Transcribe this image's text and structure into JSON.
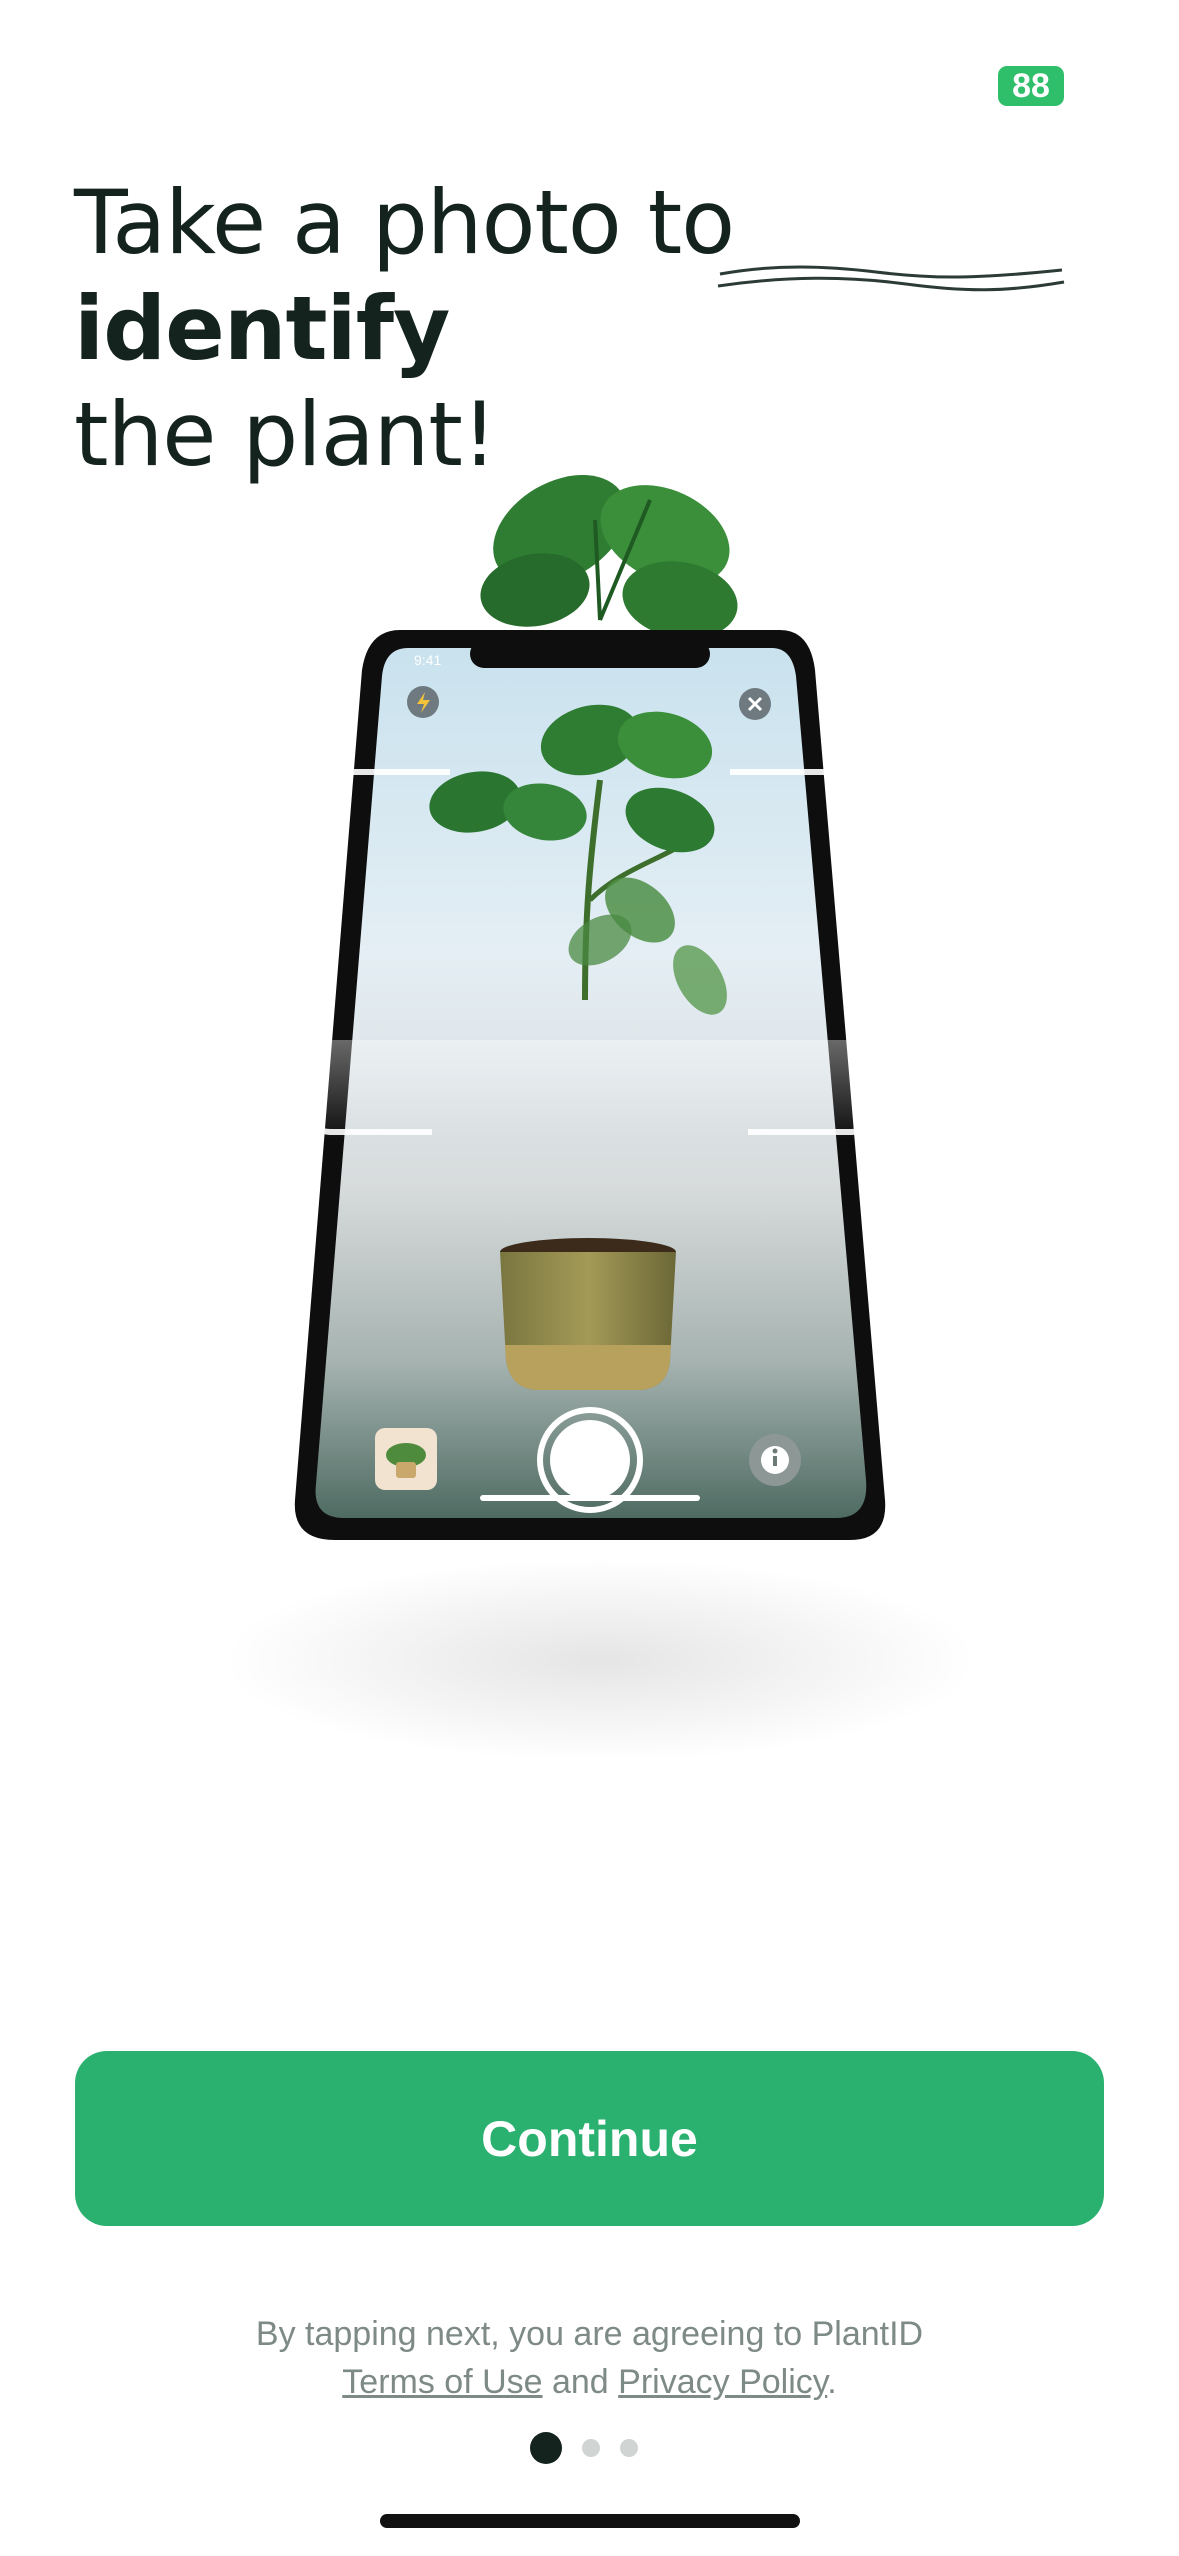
{
  "status_bar": {
    "battery": "88"
  },
  "headline": {
    "part1": "Take a photo to ",
    "emphasis": "identify",
    "part2": "the plant!"
  },
  "phone_screen": {
    "time": "9:41"
  },
  "primary_button": {
    "label": "Continue"
  },
  "legal": {
    "prefix": "By tapping next, you are agreeing to PlantID",
    "terms": "Terms of Use",
    "and": " and ",
    "privacy": "Privacy Policy",
    "suffix": "."
  },
  "pagination": {
    "current": 1,
    "total": 3
  },
  "colors": {
    "accent": "#2ab06f",
    "headline": "#14231d",
    "battery": "#2fbe6a"
  }
}
